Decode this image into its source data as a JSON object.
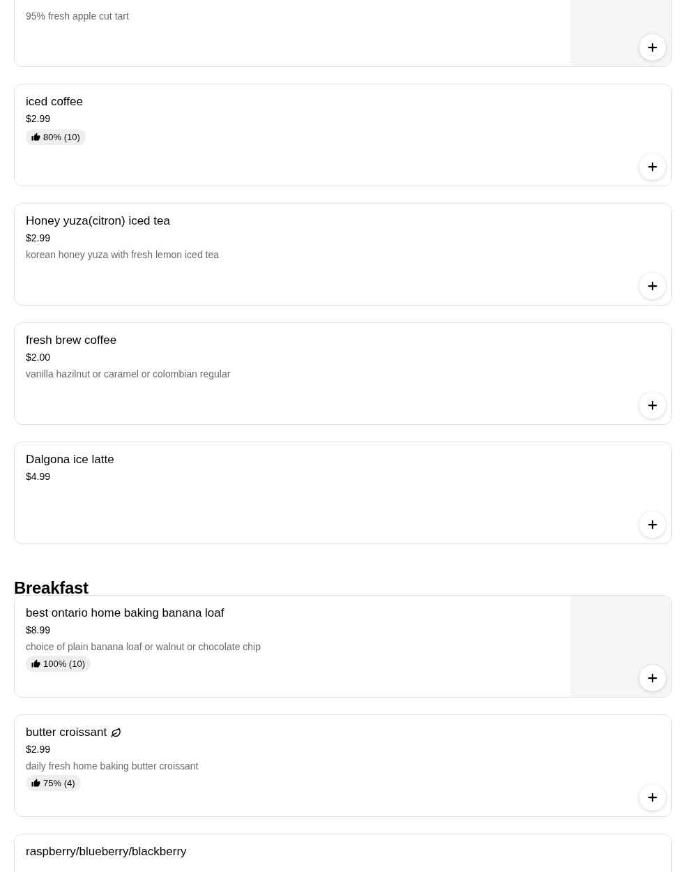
{
  "sections": [
    {
      "items": [
        {
          "description": "95% fresh apple cut tart",
          "has_image": true,
          "add_button": true
        },
        {
          "name": "iced coffee",
          "price": "$2.99",
          "rating": "80% (10)",
          "add_button": true
        },
        {
          "name": "Honey yuza(citron) iced tea",
          "price": "$2.99",
          "description": "korean honey yuza with fresh lemon iced tea",
          "add_button": true
        },
        {
          "name": "fresh brew coffee",
          "price": "$2.00",
          "description": "vanilla hazilnut or caramel or colombian regular",
          "add_button": true
        },
        {
          "name": "Dalgona ice latte",
          "price": "$4.99",
          "add_button": true
        }
      ]
    },
    {
      "heading": "Breakfast",
      "items": [
        {
          "name": "best ontario home baking banana loaf",
          "price": "$8.99",
          "description": "choice of plain banana loaf or walnut or chocolate chip",
          "rating": "100% (10)",
          "has_image": true,
          "add_button": true
        },
        {
          "name": "butter croissant",
          "vegetarian": true,
          "price": "$2.99",
          "description": "daily fresh home baking butter croissant",
          "rating": "75% (4)",
          "add_button": true
        },
        {
          "name": "raspberry/blueberry/blackberry"
        }
      ]
    }
  ]
}
